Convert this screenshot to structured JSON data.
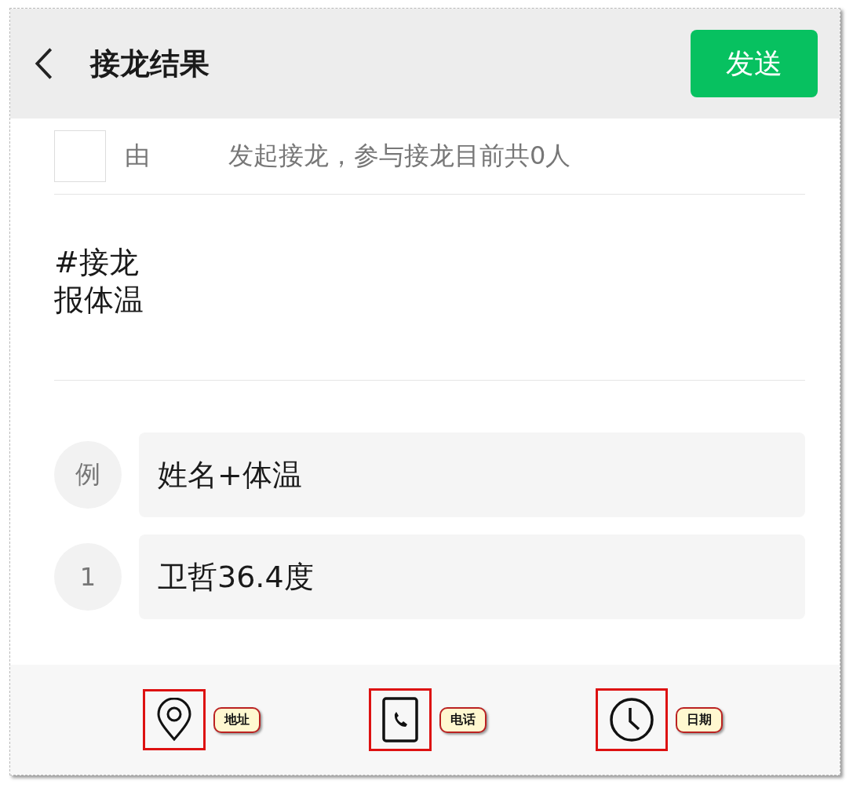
{
  "header": {
    "title": "接龙结果",
    "send_button": "发送"
  },
  "info": {
    "prefix": "由",
    "text": "发起接龙，参与接龙目前共0人"
  },
  "topic": {
    "lines": [
      "#接龙",
      "报体温"
    ]
  },
  "entries": [
    {
      "badge": "例",
      "value": "姓名+体温"
    },
    {
      "badge": "1",
      "value": "卫哲36.4度"
    }
  ],
  "toolbar": [
    {
      "kind": "location",
      "callout": "地址"
    },
    {
      "kind": "phone",
      "callout": "电话"
    },
    {
      "kind": "clock",
      "callout": "日期"
    }
  ]
}
